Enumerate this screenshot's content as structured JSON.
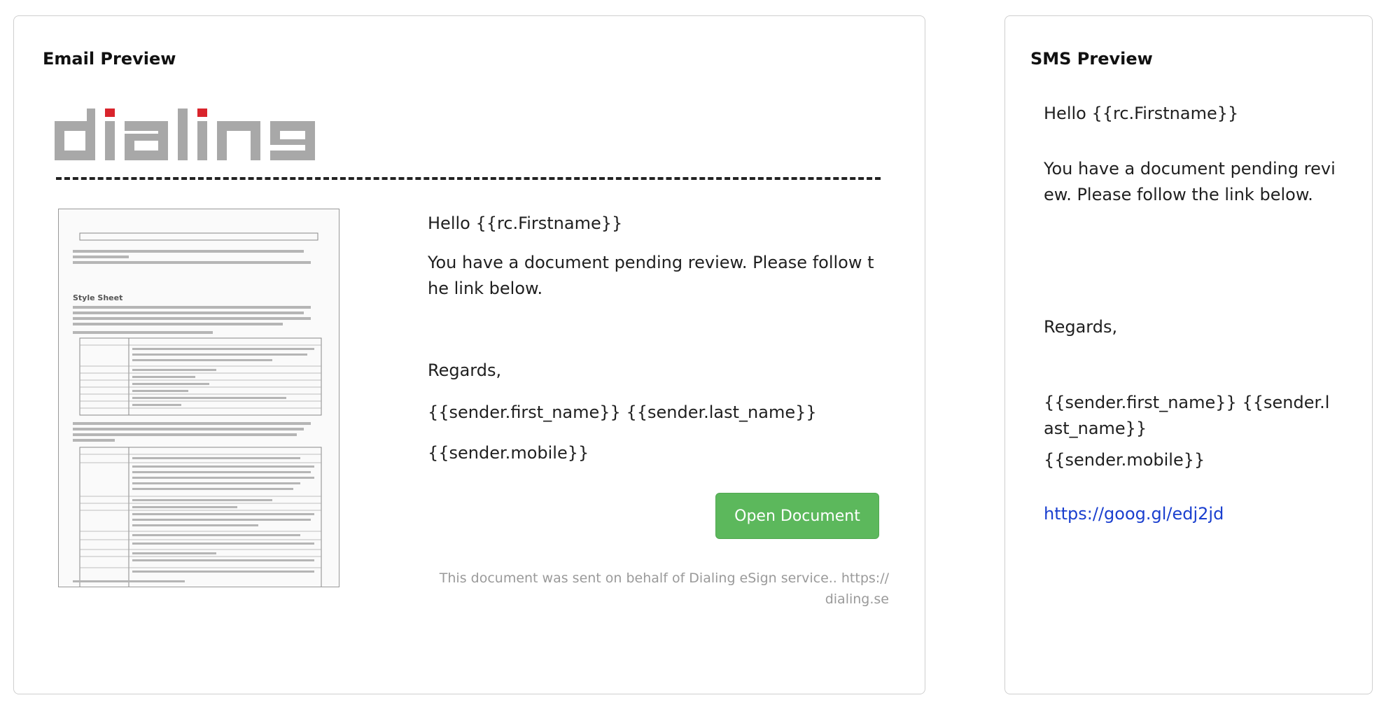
{
  "email": {
    "title": "Email Preview",
    "logo_text": "dialing",
    "greeting": "Hello {{rc.Firstname}}",
    "body": "You have a document pending review. Please follow the link below.",
    "regards": "Regards,",
    "sender_name": "{{sender.first_name}} {{sender.last_name}}",
    "sender_mobile": "{{sender.mobile}}",
    "open_button": "Open Document",
    "footer": "This document was sent on behalf of Dialing eSign service.. https://dialing.se",
    "colors": {
      "button": "#5cb85c",
      "logo_gray": "#a8a8a8",
      "logo_red": "#d9242c"
    }
  },
  "sms": {
    "title": "SMS Preview",
    "greeting": "Hello {{rc.Firstname}}",
    "body": "You have a document pending review. Please follow the link below.",
    "regards": "Regards,",
    "sender_name": "{{sender.first_name}} {{sender.last_name}}",
    "sender_mobile": "{{sender.mobile}}",
    "link": "https://goog.gl/edj2jd",
    "colors": {
      "link": "#1a3fcf"
    }
  },
  "document_thumbnail": {
    "heading": "Style Sheet",
    "icon": "document-page-thumbnail"
  }
}
